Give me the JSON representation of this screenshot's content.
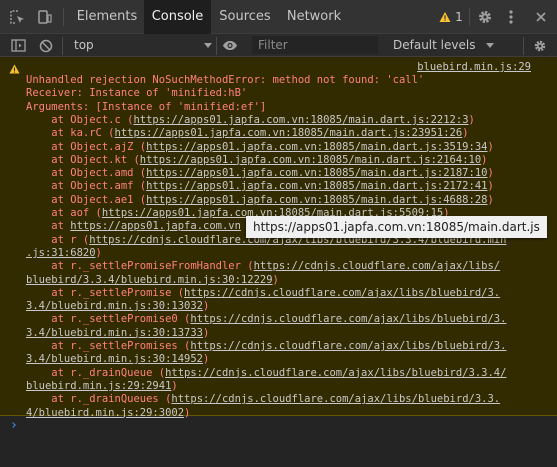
{
  "tabs": [
    "Elements",
    "Console",
    "Sources",
    "Network"
  ],
  "warnings_count": "1",
  "icons": {
    "inspect": "inspect-element-icon",
    "device": "device-toolbar-icon",
    "settings": "gear-icon",
    "more": "kebab-menu-icon",
    "sidebar": "console-sidebar-icon",
    "clear": "clear-console-icon",
    "live": "eye-icon",
    "dropdown": "chevron-down-icon",
    "warning": "warning-triangle-icon",
    "prompt": "chevron-right-icon"
  },
  "toolbar": {
    "context": "top",
    "filter_placeholder": "Filter",
    "levels": "Default levels"
  },
  "message": {
    "source": "bluebird.min.js:29",
    "lines": [
      {
        "text": "Unhandled rejection NoSuchMethodError: method not found: 'call'"
      },
      {
        "text": "Receiver: Instance of 'minified:hB'"
      },
      {
        "text": "Arguments: [Instance of 'minified:ef']"
      },
      {
        "text": "    at Object.c (",
        "link": "https://apps01.japfa.com.vn:18085/main.dart.js:2212:3",
        "tail": ")"
      },
      {
        "text": "    at ka.rC (",
        "link": "https://apps01.japfa.com.vn:18085/main.dart.js:23951:26",
        "tail": ")"
      },
      {
        "text": "    at Object.ajZ (",
        "link": "https://apps01.japfa.com.vn:18085/main.dart.js:3519:34",
        "tail": ")"
      },
      {
        "text": "    at Object.kt (",
        "link": "https://apps01.japfa.com.vn:18085/main.dart.js:2164:10",
        "tail": ")"
      },
      {
        "text": "    at Object.amd (",
        "link": "https://apps01.japfa.com.vn:18085/main.dart.js:2187:10",
        "tail": ")"
      },
      {
        "text": "    at Object.amf (",
        "link": "https://apps01.japfa.com.vn:18085/main.dart.js:2172:41",
        "tail": ")"
      },
      {
        "text": "    at Object.ae1 (",
        "link": "https://apps01.japfa.com.vn:18085/main.dart.js:4688:28",
        "tail": ")"
      },
      {
        "text": "    at aof (",
        "link": "https://apps01.japfa.com.vn:18085/main.dart.js:5509:15",
        "tail": ")"
      },
      {
        "text": "    at ",
        "link": "https://apps01.japfa.com.vn",
        "tail": ""
      },
      {
        "text": "    at r (",
        "link": "https://cdnjs.cloudflare.com/ajax/libs/bluebird/3.3.4/bluebird.min",
        "tail": ""
      },
      {
        "text": "",
        "link": ".js:31:6820",
        "tail": ")"
      },
      {
        "text": "    at r._settlePromiseFromHandler (",
        "link": "https://cdnjs.cloudflare.com/ajax/libs/",
        "tail": ""
      },
      {
        "text": "",
        "link": "bluebird/3.3.4/bluebird.min.js:30:12229",
        "tail": ")"
      },
      {
        "text": "    at r._settlePromise (",
        "link": "https://cdnjs.cloudflare.com/ajax/libs/bluebird/3.",
        "tail": ""
      },
      {
        "text": "",
        "link": "3.4/bluebird.min.js:30:13032",
        "tail": ")"
      },
      {
        "text": "    at r._settlePromise0 (",
        "link": "https://cdnjs.cloudflare.com/ajax/libs/bluebird/3.",
        "tail": ""
      },
      {
        "text": "",
        "link": "3.4/bluebird.min.js:30:13733",
        "tail": ")"
      },
      {
        "text": "    at r._settlePromises (",
        "link": "https://cdnjs.cloudflare.com/ajax/libs/bluebird/3.",
        "tail": ""
      },
      {
        "text": "",
        "link": "3.4/bluebird.min.js:30:14952",
        "tail": ")"
      },
      {
        "text": "    at r._drainQueue (",
        "link": "https://cdnjs.cloudflare.com/ajax/libs/bluebird/3.3.4/",
        "tail": ""
      },
      {
        "text": "",
        "link": "bluebird.min.js:29:2941",
        "tail": ")"
      },
      {
        "text": "    at r._drainQueues (",
        "link": "https://cdnjs.cloudflare.com/ajax/libs/bluebird/3.3.",
        "tail": ""
      },
      {
        "text": "",
        "link": "4/bluebird.min.js:29:3002",
        "tail": ")"
      }
    ]
  },
  "tooltip": "https://apps01.japfa.com.vn:18085/main.dart.js",
  "colors": {
    "error_text": "#ff8080",
    "warning_bg": "#332b00",
    "warning_icon": "#f9c22e",
    "active_tab_underline": "#3b9af2"
  }
}
